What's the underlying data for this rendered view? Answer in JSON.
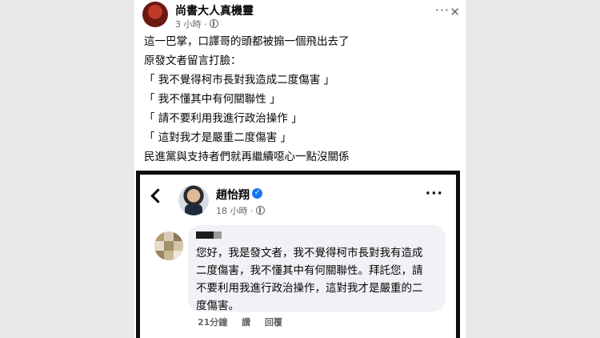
{
  "post": {
    "author": "尚書大人真機靈",
    "time": "3 小時 ·",
    "more": "···",
    "close": "✕",
    "lines": [
      "這一巴掌，口譯哥的頭都被搧一個飛出去了",
      "原發文者留言打臉：",
      "「 我不覺得柯市長對我造成二度傷害 」",
      "「 我不懂其中有何關聯性 」",
      "「 請不要利用我進行政治操作 」",
      "「 這對我才是嚴重二度傷害 」",
      "民進黨與支持者們就再繼續噁心一點沒關係"
    ]
  },
  "embed": {
    "author": "趙怡翔",
    "verified": "✓",
    "time": "18 小時 ·",
    "more": "···",
    "comment": {
      "lines": [
        "您好，我是發文者，我不覺得柯市長對我有造成",
        "二度傷害，我不懂其中有何關聯性。拜託您，請",
        "不要利用我進行政治操作，這對我才是嚴重的二",
        "度傷害。"
      ],
      "time": "21分鐘",
      "read_label": "讚",
      "reply_label": "回覆"
    }
  }
}
